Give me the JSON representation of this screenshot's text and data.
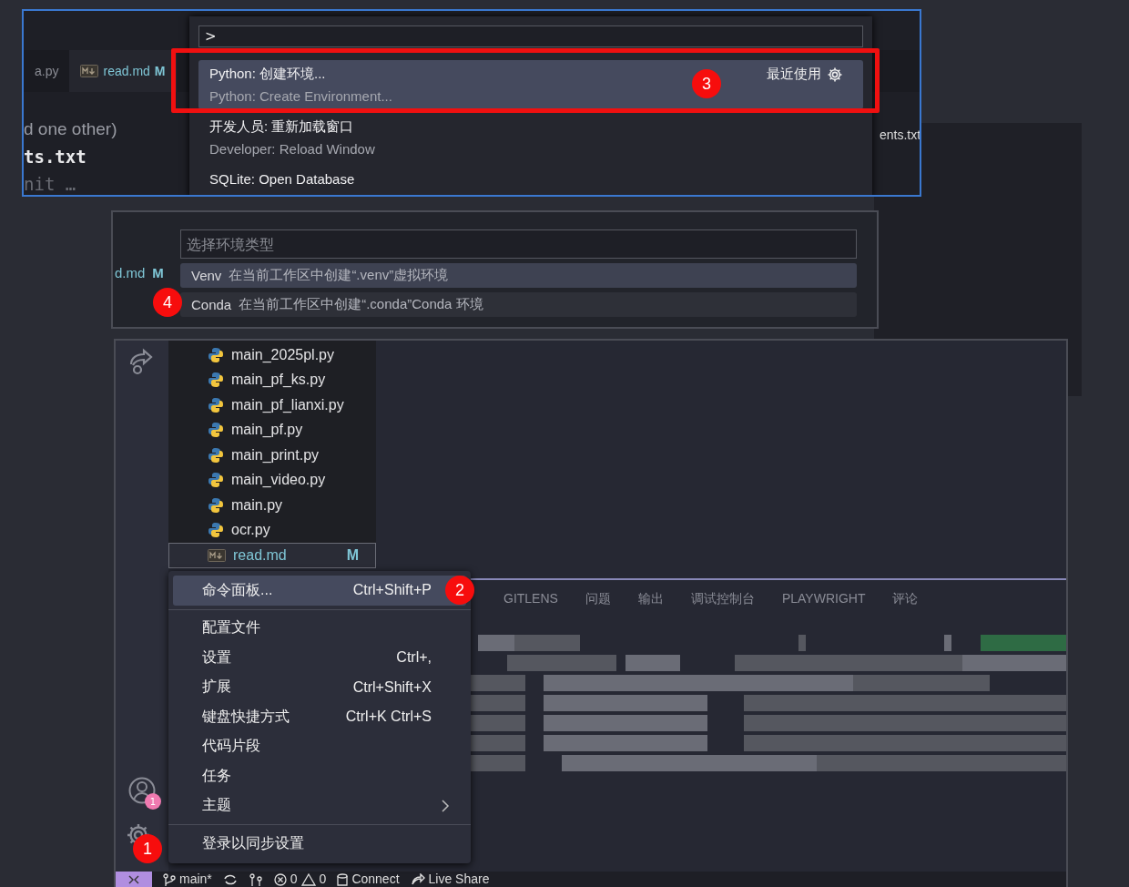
{
  "command_palette_shot": {
    "tabs": [
      {
        "label": "a.py",
        "selected": false
      },
      {
        "label": "read.md",
        "status": "M",
        "selected": true
      }
    ],
    "editor_lines": [
      "d one other)",
      "ts.txt",
      "nit …"
    ],
    "side_text": "ents.txt",
    "quick_input": {
      "value": ">",
      "items": [
        {
          "label": "Python: 创建环境...",
          "detail": "Python: Create Environment...",
          "hint": "最近使用",
          "selected": true
        },
        {
          "label": "开发人员: 重新加载窗口",
          "detail": "Developer: Reload Window",
          "selected": false
        },
        {
          "label": "SQLite: Open Database",
          "selected": false
        }
      ]
    },
    "callout": "3"
  },
  "environment_shot": {
    "tab": {
      "label": "d.md",
      "status": "M"
    },
    "quick_input": {
      "placeholder": "选择环境类型",
      "items": [
        {
          "label": "Venv",
          "description": "在当前工作区中创建“.venv”虚拟环境",
          "selected": true
        },
        {
          "label": "Conda",
          "description": "在当前工作区中创建“.conda”Conda 环境",
          "selected": false
        }
      ]
    },
    "callout": "4"
  },
  "editor_shot": {
    "accounts_badge": "1",
    "settings_callout": "1",
    "files": [
      {
        "name": "main_2025pl.py",
        "kind": "python",
        "selected": false
      },
      {
        "name": "main_pf_ks.py",
        "kind": "python",
        "selected": false
      },
      {
        "name": "main_pf_lianxi.py",
        "kind": "python",
        "selected": false
      },
      {
        "name": "main_pf.py",
        "kind": "python",
        "selected": false
      },
      {
        "name": "main_print.py",
        "kind": "python",
        "selected": false
      },
      {
        "name": "main_video.py",
        "kind": "python",
        "selected": false
      },
      {
        "name": "main.py",
        "kind": "python",
        "selected": false
      },
      {
        "name": "ocr.py",
        "kind": "python",
        "selected": false
      },
      {
        "name": "read.md",
        "kind": "markdown",
        "status": "M",
        "selected": true
      }
    ],
    "menu": {
      "callout": "2",
      "items": [
        {
          "kind": "item",
          "label": "命令面板...",
          "shortcut": "Ctrl+Shift+P",
          "selected": true
        },
        {
          "kind": "separator"
        },
        {
          "kind": "item",
          "label": "配置文件",
          "selected": false
        },
        {
          "kind": "item",
          "label": "设置",
          "shortcut": "Ctrl+,",
          "selected": false
        },
        {
          "kind": "item",
          "label": "扩展",
          "shortcut": "Ctrl+Shift+X",
          "selected": false
        },
        {
          "kind": "item",
          "label": "键盘快捷方式",
          "shortcut": "Ctrl+K Ctrl+S",
          "selected": false
        },
        {
          "kind": "item",
          "label": "代码片段",
          "selected": false
        },
        {
          "kind": "item",
          "label": "任务",
          "selected": false
        },
        {
          "kind": "item",
          "label": "主题",
          "submenu": true,
          "selected": false
        },
        {
          "kind": "separator"
        },
        {
          "kind": "item",
          "label": "登录以同步设置",
          "selected": false
        }
      ]
    },
    "panel_tabs": [
      "GITLENS",
      "问题",
      "输出",
      "调试控制台",
      "PLAYWRIGHT",
      "评论"
    ],
    "terminal": {
      "kind": "picture"
    },
    "status_bar": [
      {
        "kind": "remote"
      },
      {
        "kind": "branch",
        "text": "main*"
      },
      {
        "kind": "sync"
      },
      {
        "kind": "graph"
      },
      {
        "kind": "problems",
        "errors": "0",
        "warnings": "0"
      },
      {
        "kind": "database",
        "text": "Connect"
      },
      {
        "kind": "liveshare",
        "text": "Live Share"
      }
    ]
  }
}
